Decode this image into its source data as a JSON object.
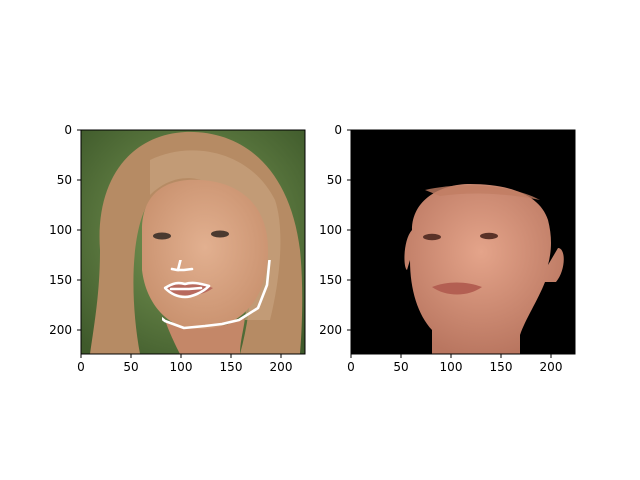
{
  "figure": {
    "panels": [
      {
        "id": "left",
        "description_free_image": "photo",
        "xlim": [
          0,
          224
        ],
        "ylim": [
          224,
          0
        ],
        "xticks": [
          "0",
          "50",
          "100",
          "150",
          "200"
        ],
        "yticks": [
          "0",
          "50",
          "100",
          "150",
          "200"
        ],
        "background_color": "#5c7a3a",
        "skin_color": "#d6a07f",
        "hair_color": "#b9916a"
      },
      {
        "id": "right",
        "description_free_image": "render",
        "xlim": [
          0,
          224
        ],
        "ylim": [
          224,
          0
        ],
        "xticks": [
          "0",
          "50",
          "100",
          "150",
          "200"
        ],
        "yticks": [
          "0",
          "50",
          "100",
          "150",
          "200"
        ],
        "background_color": "#000000",
        "skin_color": "#cf8d74"
      }
    ],
    "landmark_color": "#ffffff"
  }
}
